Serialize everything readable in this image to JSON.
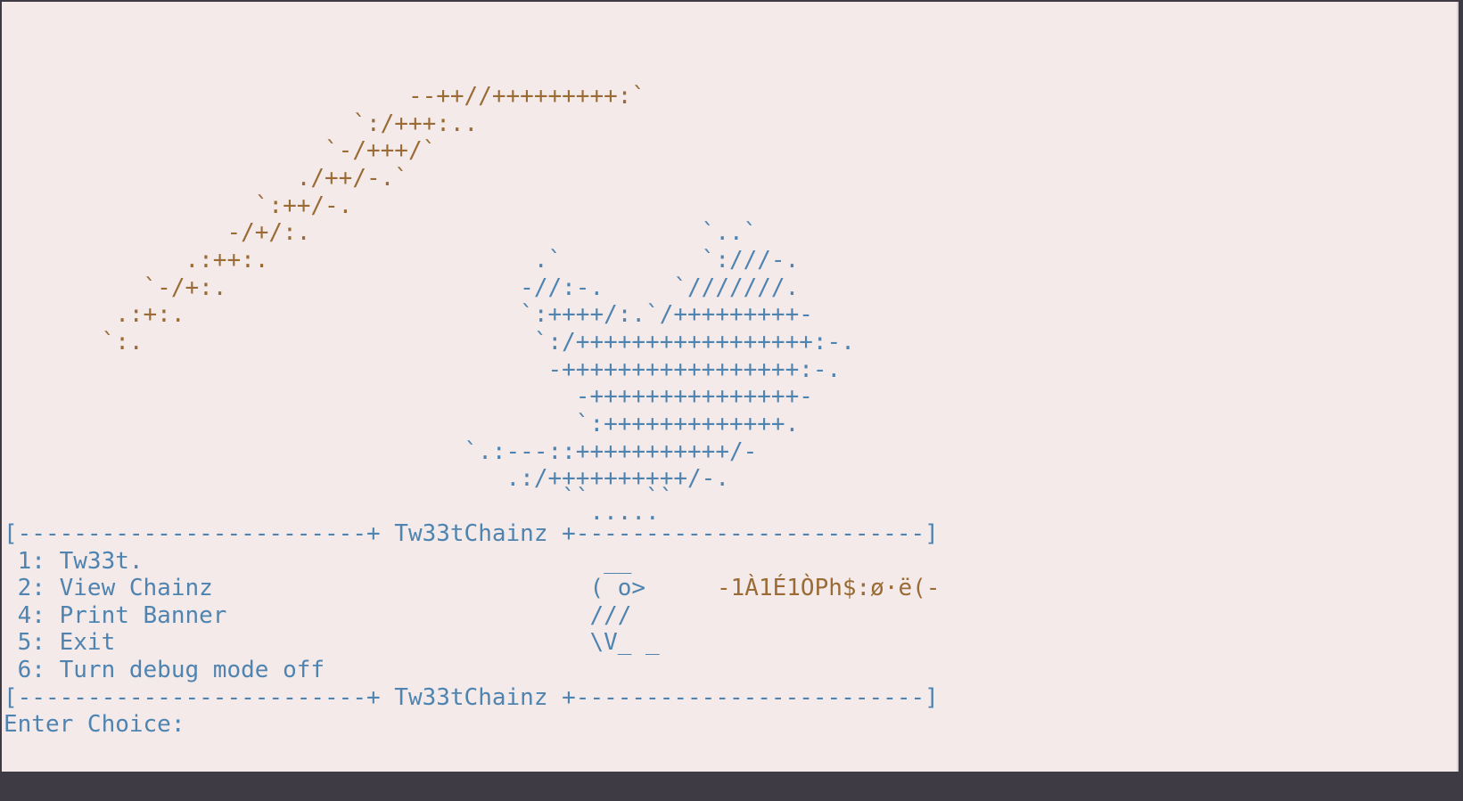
{
  "banner": {
    "orange_lines": [
      "                             --++//+++++++++:`",
      "                         `:/+++:..",
      "                       `-/+++/`",
      "                     ./++/-.`",
      "                  `:++/-.",
      "                -/+/:.",
      "             .:++:.",
      "          `-/+:.",
      "        .:+:.",
      "       `:."
    ],
    "blue_lines": [
      "                                                  `..`",
      "                                      .`          `:///-.",
      "                                     -//:-.     `///////.",
      "                                     `:++++/:.`/+++++++++-",
      "                                      `:/+++++++++++++++++:-.",
      "                                       -+++++++++++++++++:-.",
      "                                         -+++++++++++++++-",
      "                                         `:+++++++++++++.",
      "                                 `.:---::+++++++++++/-",
      "                                    .:/++++++++++/-.",
      "                                        ``    ``",
      "                                          ....."
    ]
  },
  "menu": {
    "separator_top": "[-------------------------+ Tw33tChainz +-------------------------]",
    "items": [
      " 1: Tw33t.",
      " 2: View Chainz",
      " 4: Print Banner",
      " 5: Exit",
      " 6: Turn debug mode off"
    ],
    "bird": [
      "                                           __",
      "                                          ( o>",
      "                                          ///",
      "                                          \\V_ _"
    ],
    "garbage": "-1À1É1ÒPh$:ø·ë(-",
    "separator_bottom": "[-------------------------+ Tw33tChainz +-------------------------]",
    "prompt": "Enter Choice: "
  },
  "colors": {
    "background": "#f4eaea",
    "frame": "#3f3b45",
    "orange": "#9a6b34",
    "blue": "#4f84b0"
  }
}
